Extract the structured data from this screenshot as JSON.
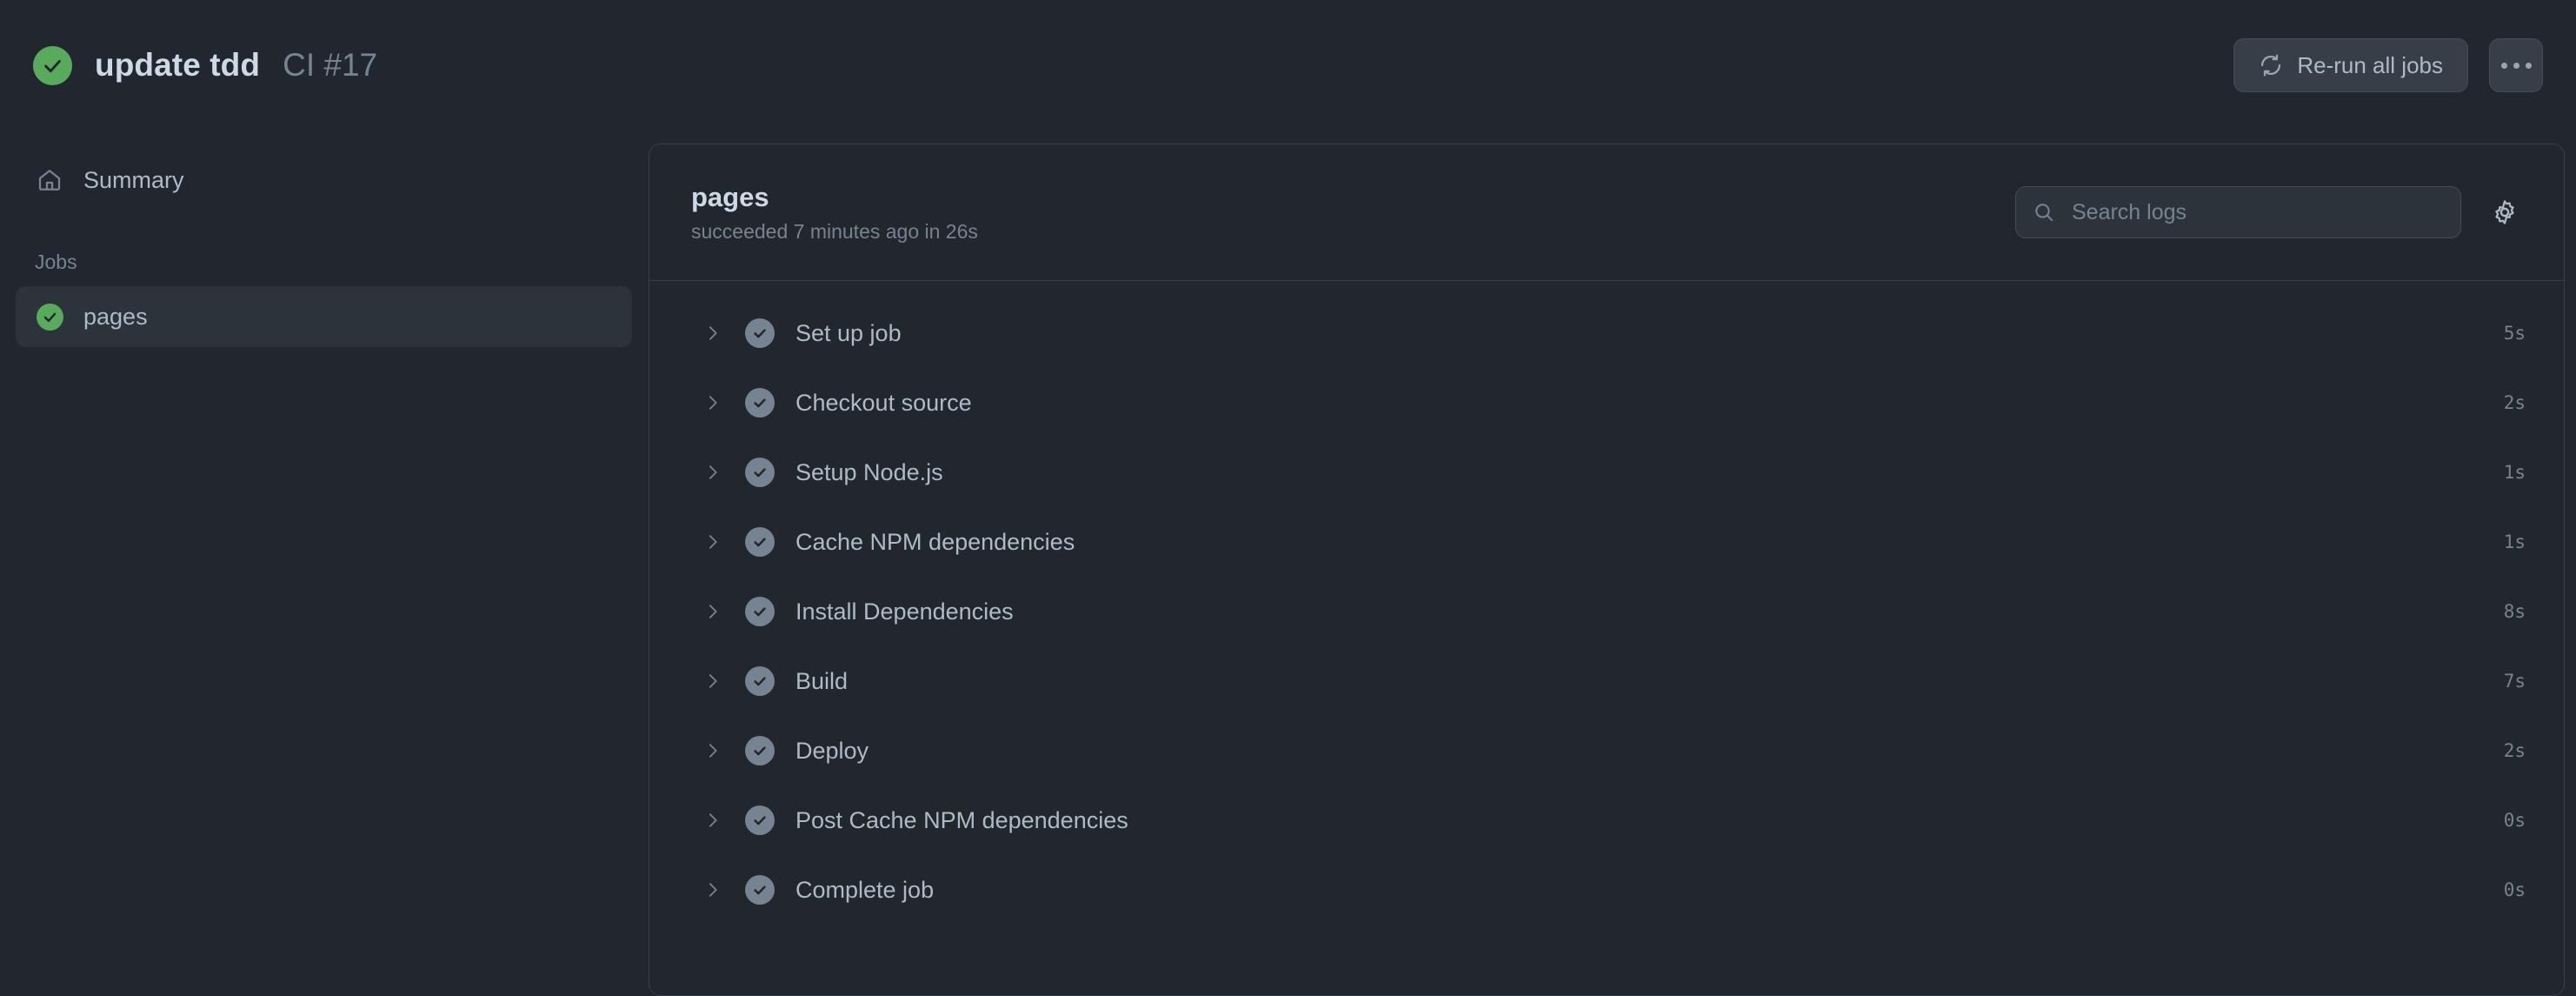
{
  "header": {
    "status_icon": "check-circle-green-icon",
    "run_title": "update tdd",
    "run_subtitle": "CI #17",
    "rerun_button": {
      "label": "Re-run all jobs",
      "icon": "sync-refresh-icon"
    },
    "kebab_button": {
      "icon": "kebab-horizontal-icon"
    }
  },
  "sidebar": {
    "summary": {
      "label": "Summary",
      "icon": "home-icon"
    },
    "jobs_heading": "Jobs",
    "jobs": [
      {
        "label": "pages",
        "icon": "check-circle-green-icon",
        "selected": true
      }
    ]
  },
  "panel": {
    "title": "pages",
    "subtitle": "succeeded 7 minutes ago in 26s",
    "search": {
      "placeholder": "Search logs",
      "value": "",
      "icon": "search-icon"
    },
    "settings_icon": "gear-icon",
    "steps": [
      {
        "name": "Set up job",
        "duration": "5s",
        "status": "success"
      },
      {
        "name": "Checkout source",
        "duration": "2s",
        "status": "success"
      },
      {
        "name": "Setup Node.js",
        "duration": "1s",
        "status": "success"
      },
      {
        "name": "Cache NPM dependencies",
        "duration": "1s",
        "status": "success"
      },
      {
        "name": "Install Dependencies",
        "duration": "8s",
        "status": "success"
      },
      {
        "name": "Build",
        "duration": "7s",
        "status": "success"
      },
      {
        "name": "Deploy",
        "duration": "2s",
        "status": "success"
      },
      {
        "name": "Post Cache NPM dependencies",
        "duration": "0s",
        "status": "success"
      },
      {
        "name": "Complete job",
        "duration": "0s",
        "status": "success"
      }
    ]
  },
  "colors": {
    "page_background": "#22262e",
    "panel_background": "#22272e",
    "border": "#373e47",
    "success_green": "#57ab5a",
    "text_primary": "#cdd9e5",
    "text_secondary": "#adbac7",
    "text_muted": "#768390",
    "step_check_gray": "#768390",
    "selected_row": "#2d333b"
  }
}
